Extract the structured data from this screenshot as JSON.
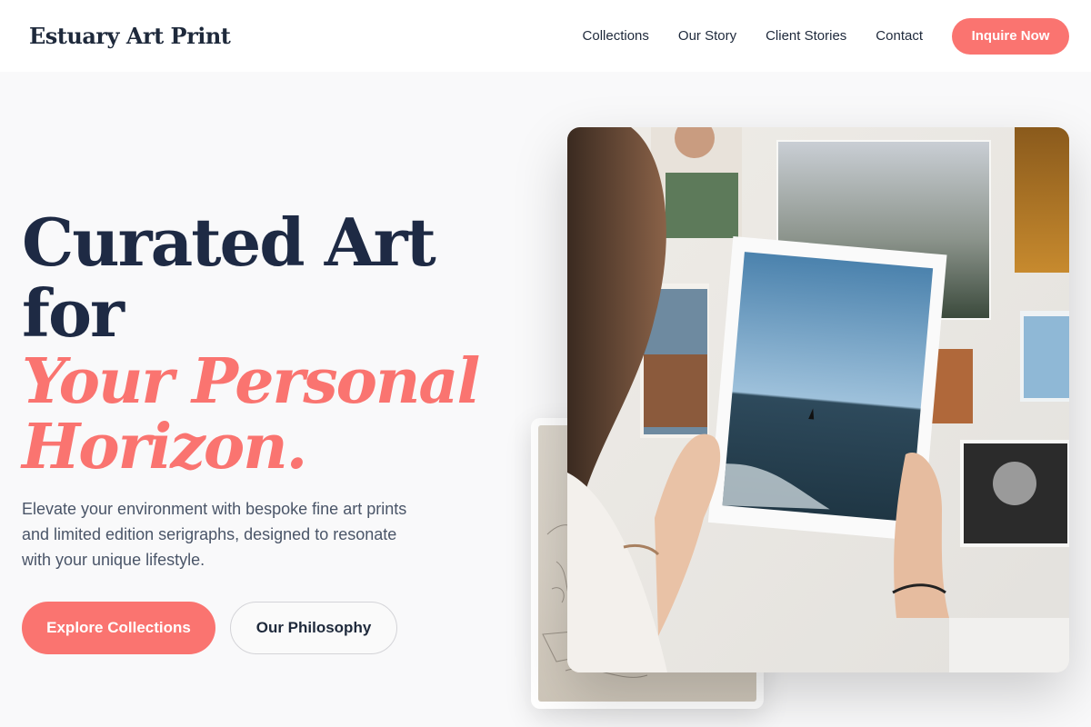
{
  "brand": {
    "name": "Estuary Art Print"
  },
  "nav": {
    "links": [
      "Collections",
      "Our Story",
      "Client Stories",
      "Contact"
    ],
    "cta": "Inquire Now"
  },
  "hero": {
    "title_line1": "Curated Art for",
    "title_accent_line1": "Your Personal",
    "title_accent_line2": "Horizon.",
    "description": "Elevate your environment with bespoke fine art prints and limited edition serigraphs, designed to resonate with your unique lifestyle.",
    "primary_cta": "Explore Collections",
    "secondary_cta": "Our Philosophy"
  },
  "colors": {
    "accent": "#fa7470",
    "heading": "#1e2a44",
    "body_text": "#4a5568",
    "background": "#f9f9fa"
  }
}
